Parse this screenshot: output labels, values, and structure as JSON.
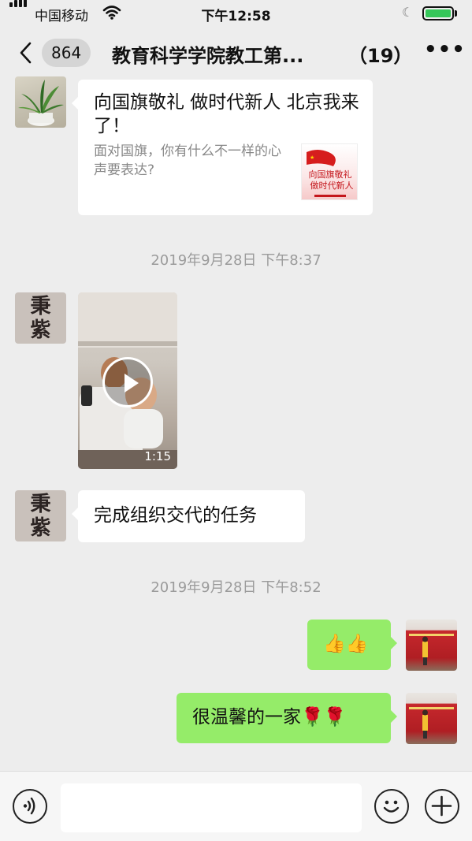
{
  "status_bar": {
    "carrier": "中国移动",
    "time": "下午12:58",
    "battery_color": "#35c759"
  },
  "nav": {
    "unread_count": "864",
    "title": "教育科学学院教工第...",
    "member_count": "（19）",
    "icons": [
      "chevron-left-icon",
      "more-icon"
    ]
  },
  "messages": {
    "link_card": {
      "title": "向国旗敬礼 做时代新人 北京我来了！",
      "description": "面对国旗，你有什么不一样的心声要表达?",
      "thumb_text_line1": "向国旗敬礼",
      "thumb_text_line2": "做时代新人"
    },
    "timestamp1": "2019年9月28日 下午8:37",
    "avatar_callig": "秉\n紫",
    "video": {
      "duration": "1:15"
    },
    "text_in": "完成组织交代的任务",
    "timestamp2": "2019年9月28日 下午8:52",
    "text_out1": "👍👍",
    "text_out2": "很温馨的一家🌹🌹"
  },
  "input_bar": {
    "icons": [
      "voice-icon",
      "emoji-icon",
      "plus-icon"
    ]
  },
  "colors": {
    "background": "#ededed",
    "outgoing_bubble": "#95ec69",
    "incoming_bubble": "#ffffff",
    "timestamp": "#9b9b9b"
  }
}
